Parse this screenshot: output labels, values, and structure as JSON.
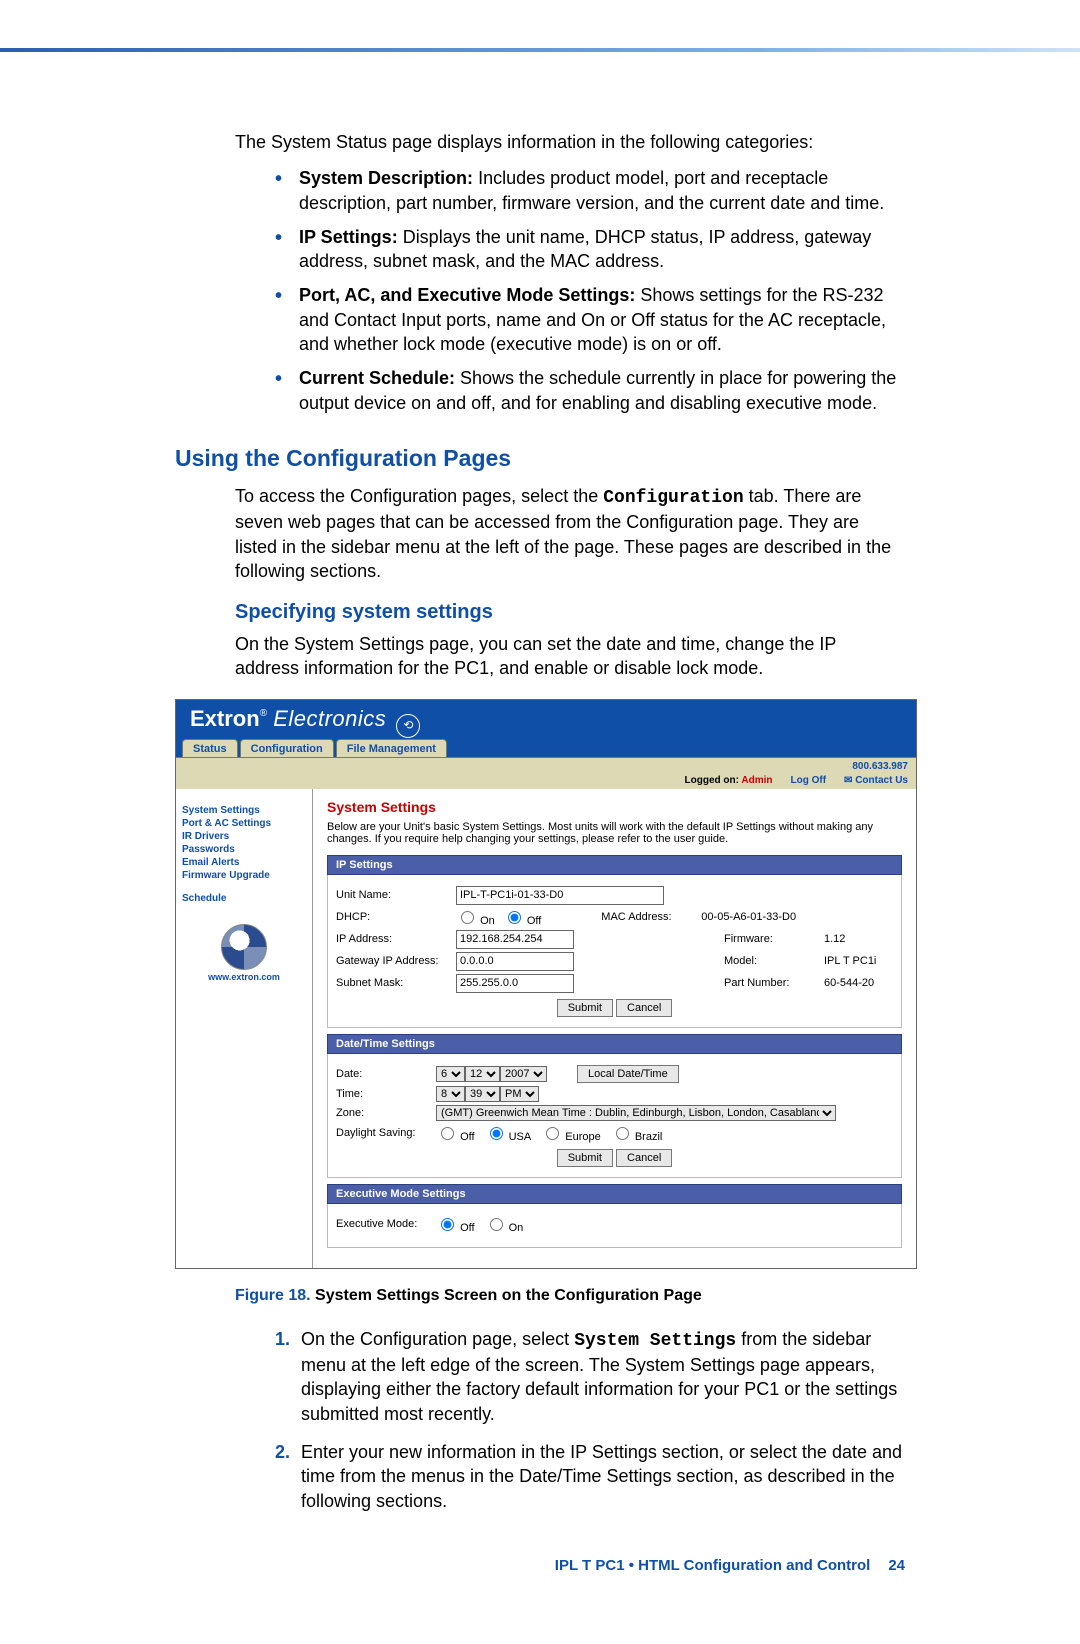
{
  "intro": "The System Status page displays information in the following categories:",
  "bullets": [
    {
      "label": "System Description:",
      "text": " Includes product model, port and receptacle description, part number, firmware version, and the current date and time."
    },
    {
      "label": "IP Settings:",
      "text": " Displays the unit name, DHCP status, IP address, gateway address, subnet mask, and the MAC address."
    },
    {
      "label": "Port, AC, and Executive Mode Settings:",
      "text": " Shows settings for the RS-232 and Contact Input ports, name and On or Off status for the AC receptacle, and whether lock mode (executive mode) is on or off."
    },
    {
      "label": "Current Schedule:",
      "text": " Shows the schedule currently in place for powering the output device on and off, and for enabling and disabling executive mode."
    }
  ],
  "section_heading": "Using the Configuration Pages",
  "section_p1a": "To access the Configuration pages, select the ",
  "section_p1_code": "Configuration",
  "section_p1b": " tab. There are seven web pages that can be accessed from the Configuration page. They are listed in the sidebar menu at the left of the page. These pages are described in the following sections.",
  "sub_heading": "Specifying system settings",
  "sub_p": "On the System Settings page, you can set the date and time, change the IP address information for the PC1, and enable or disable lock mode.",
  "embed": {
    "brand_a": "Extron",
    "brand_b": "Electronics",
    "tabs": [
      "Status",
      "Configuration",
      "File Management"
    ],
    "phone": "800.633.987",
    "logged_on_label": "Logged on: ",
    "logged_on_user": "Admin",
    "logoff": "Log Off",
    "contact": "Contact Us",
    "sidebar": [
      "System Settings",
      "Port & AC Settings",
      "IR Drivers",
      "Passwords",
      "Email Alerts",
      "Firmware Upgrade"
    ],
    "sidebar2": "Schedule",
    "www": "www.extron.com",
    "title": "System Settings",
    "desc": "Below are your Unit's basic System Settings. Most units will work with the default IP Settings without making any changes. If you require help changing your settings, please refer to the user guide.",
    "panels": {
      "ip": {
        "header": "IP Settings",
        "unit_name_lbl": "Unit Name:",
        "unit_name": "IPL-T-PC1i-01-33-D0",
        "dhcp_lbl": "DHCP:",
        "on_lbl": "On",
        "off_lbl": "Off",
        "ip_lbl": "IP Address:",
        "ip": "192.168.254.254",
        "gw_lbl": "Gateway IP Address:",
        "gw": "0.0.0.0",
        "mask_lbl": "Subnet Mask:",
        "mask": "255.255.0.0",
        "mac_lbl": "MAC Address:",
        "mac": "00-05-A6-01-33-D0",
        "fw_lbl": "Firmware:",
        "fw": "1.12",
        "model_lbl": "Model:",
        "model": "IPL T PC1i",
        "part_lbl": "Part Number:",
        "part": "60-544-20",
        "submit": "Submit",
        "cancel": "Cancel"
      },
      "dt": {
        "header": "Date/Time Settings",
        "date_lbl": "Date:",
        "month": "6",
        "day": "12",
        "year": "2007",
        "local_btn": "Local Date/Time",
        "time_lbl": "Time:",
        "hour": "8",
        "minute": "39",
        "ampm": "PM",
        "zone_lbl": "Zone:",
        "zone": "(GMT) Greenwich Mean Time : Dublin, Edinburgh, Lisbon, London, Casablanca, Monrovia",
        "ds_lbl": "Daylight Saving:",
        "ds_off": "Off",
        "ds_usa": "USA",
        "ds_eu": "Europe",
        "ds_br": "Brazil",
        "submit": "Submit",
        "cancel": "Cancel"
      },
      "ex": {
        "header": "Executive Mode Settings",
        "lbl": "Executive Mode:",
        "off": "Off",
        "on": "On"
      }
    }
  },
  "figure_pre": "Figure 18. ",
  "figure_text": "System Settings Screen on the Configuration Page",
  "steps": [
    {
      "pre": "On the Configuration page, select ",
      "code": "System Settings",
      "post": " from the sidebar menu at the left edge of the screen. The System Settings page appears, displaying either the factory default information for your PC1 or the settings submitted most recently."
    },
    {
      "pre": "Enter your new information in the IP Settings section, or select the date and time from the menus in the Date/Time Settings section, as described in the following sections.",
      "code": "",
      "post": ""
    }
  ],
  "footer_text": "IPL T PC1 • HTML Configuration and Control",
  "page_num": "24"
}
